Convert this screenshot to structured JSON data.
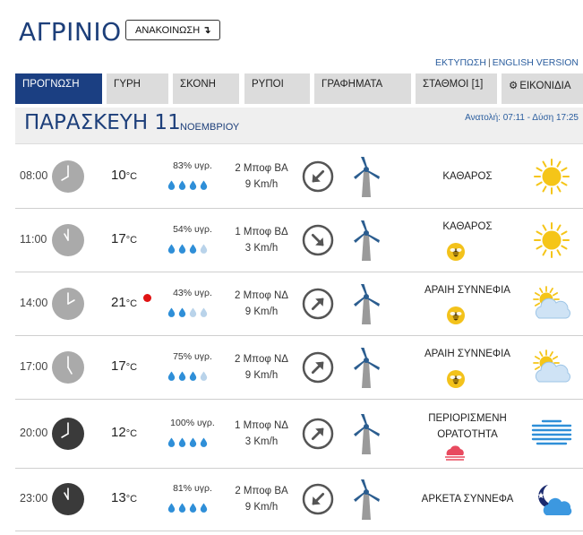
{
  "header": {
    "city": "ΑΓΡΙΝΙΟ",
    "announce_label": "ΑΝΑΚΟΙΝΩΣΗ",
    "announce_icon": "turn-down-arrow-icon",
    "print_link": "ΕΚΤΥΠΩΣΗ",
    "separator": "|",
    "english_link": "ENGLISH VERSION"
  },
  "tabs": [
    {
      "label": "ΠΡΟΓΝΩΣΗ",
      "active": true
    },
    {
      "label": "ΓΥΡΗ"
    },
    {
      "label": "ΣΚΟΝΗ"
    },
    {
      "label": "ΡΥΠΟΙ"
    },
    {
      "label": "ΓΡΑΦΗΜΑΤΑ"
    },
    {
      "label": "ΣΤΑΘΜΟΙ [1]"
    },
    {
      "label": "ΕΙΚΟΝΙΔΙΑ",
      "icon": "gear-icon"
    }
  ],
  "day": {
    "name": "ΠΑΡΑΣΚΕΥΗ 11",
    "month": "ΝΟΕΜΒΡΙΟΥ",
    "sun_text": "Ανατολή: 07:11 - Δύση 17:25"
  },
  "unit_temp": "°C",
  "forecast": [
    {
      "time": "08:00",
      "clock_dark": false,
      "temp": "10",
      "hum": "83% υγρ.",
      "drops_full": 4,
      "bft": "2 Μποφ ΒΑ",
      "kmh": "9 Km/h",
      "wind_to": "sw",
      "cond": "ΚΑΘΑΡΟΣ",
      "cond_line2": "",
      "pollen": false,
      "mist": false,
      "weather_icon": "sun-icon"
    },
    {
      "time": "11:00",
      "clock_dark": false,
      "temp": "17",
      "hum": "54% υγρ.",
      "drops_full": 3,
      "bft": "1 Μποφ ΒΔ",
      "kmh": "3 Km/h",
      "wind_to": "se",
      "cond": "ΚΑΘΑΡΟΣ",
      "cond_line2": "",
      "pollen": true,
      "mist": false,
      "weather_icon": "sun-icon"
    },
    {
      "time": "14:00",
      "clock_dark": false,
      "temp": "21",
      "max_dot": true,
      "hum": "43% υγρ.",
      "drops_full": 2,
      "bft": "2 Μποφ ΝΔ",
      "kmh": "9 Km/h",
      "wind_to": "ne",
      "cond": "ΑΡΑΙΗ ΣΥΝΝΕΦΙΑ",
      "cond_line2": "",
      "pollen": true,
      "mist": false,
      "weather_icon": "sun-cloud-icon"
    },
    {
      "time": "17:00",
      "clock_dark": false,
      "temp": "17",
      "hum": "75% υγρ.",
      "drops_full": 3,
      "bft": "2 Μποφ ΝΔ",
      "kmh": "9 Km/h",
      "wind_to": "ne",
      "cond": "ΑΡΑΙΗ ΣΥΝΝΕΦΙΑ",
      "cond_line2": "",
      "pollen": true,
      "mist": false,
      "weather_icon": "sun-cloud-icon"
    },
    {
      "time": "20:00",
      "clock_dark": true,
      "temp": "12",
      "hum": "100% υγρ.",
      "drops_full": 4,
      "bft": "1 Μποφ ΝΔ",
      "kmh": "3 Km/h",
      "wind_to": "ne",
      "cond": "ΠΕΡΙΟΡΙΣΜΕΝΗ",
      "cond_line2": "ΟΡΑΤΟΤΗΤΑ",
      "pollen": false,
      "mist": true,
      "weather_icon": "fog-icon"
    },
    {
      "time": "23:00",
      "clock_dark": true,
      "temp": "13",
      "hum": "81% υγρ.",
      "drops_full": 4,
      "bft": "2 Μποφ ΒΑ",
      "kmh": "9 Km/h",
      "wind_to": "sw",
      "cond": "ΑΡΚΕΤΑ ΣΥΝΝΕΦΑ",
      "cond_line2": "",
      "pollen": false,
      "mist": false,
      "weather_icon": "moon-cloud-icon"
    }
  ],
  "colors": {
    "brand": "#1b3f82",
    "tab_bg": "#dcdcdc",
    "drop_full": "#2f8fd8",
    "drop_empty": "#b9d3ea",
    "sun": "#f5c518",
    "max_dot": "#e01313"
  }
}
